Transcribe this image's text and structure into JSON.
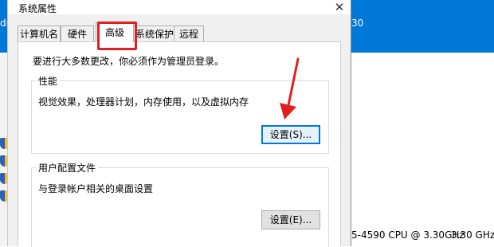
{
  "background": {
    "left_fragment": "dm",
    "right_fragment": "30",
    "cpu_text": "5-4590 CPU @ 3.30GHz",
    "ghz_text": "3.30 GHz"
  },
  "dialog": {
    "title": "系统属性",
    "close_glyph": "✕",
    "tabs": [
      {
        "label": "计算机名"
      },
      {
        "label": "硬件"
      },
      {
        "label": "高级",
        "active": true
      },
      {
        "label": "系统保护"
      },
      {
        "label": "远程"
      }
    ],
    "admin_note": "要进行大多数更改，你必须作为管理员登录。",
    "performance": {
      "label": "性能",
      "description": "视觉效果，处理器计划，内存使用，以及虚拟内存",
      "settings_button": "设置(S)..."
    },
    "user_profiles": {
      "label": "用户配置文件",
      "description": "与登录帐户相关的桌面设置",
      "settings_button": "设置(E)..."
    }
  },
  "annotation": {
    "highlight_color": "#e02020",
    "arrow_color": "#e02020"
  },
  "colors": {
    "accent": "#0078d7",
    "dialog_bg": "#f0f0f0"
  }
}
